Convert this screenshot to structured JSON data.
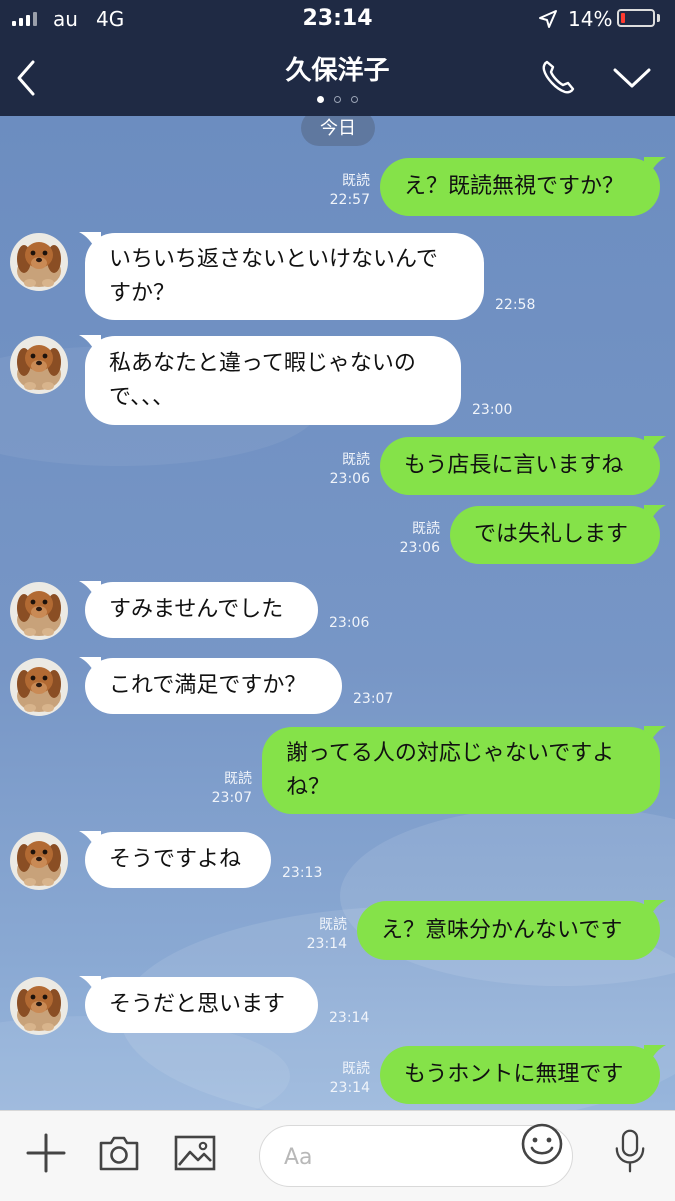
{
  "status_bar": {
    "carrier": "au",
    "network": "4G",
    "time": "23:14",
    "battery": "14%",
    "battery_level": 0.14
  },
  "nav": {
    "title": "久保洋子"
  },
  "chat": {
    "date_label": "今日",
    "messages": [
      {
        "dir": "out",
        "text": "え？既読無視ですか？",
        "read": "既読",
        "time": "22:57"
      },
      {
        "dir": "in",
        "text": "いちいち返さないといけないんで\nすか？",
        "time": "22:58"
      },
      {
        "dir": "in",
        "text": "私あなたと違って暇じゃないの\nで、、、",
        "time": "23:00"
      },
      {
        "dir": "out",
        "text": "もう店長に言いますね",
        "read": "既読",
        "time": "23:06"
      },
      {
        "dir": "out",
        "text": "では失礼します",
        "read": "既読",
        "time": "23:06"
      },
      {
        "dir": "in",
        "text": "すみませんでした",
        "time": "23:06"
      },
      {
        "dir": "in",
        "text": "これで満足ですか？",
        "time": "23:07"
      },
      {
        "dir": "out",
        "text": "謝ってる人の対応じゃないですよ\nね？",
        "read": "既読",
        "time": "23:07"
      },
      {
        "dir": "in",
        "text": "そうですよね",
        "time": "23:13"
      },
      {
        "dir": "out",
        "text": "え？意味分かんないです",
        "read": "既読",
        "time": "23:14"
      },
      {
        "dir": "in",
        "text": "そうだと思います",
        "time": "23:14"
      },
      {
        "dir": "out",
        "text": "もうホントに無理です",
        "read": "既読",
        "time": "23:14"
      }
    ]
  },
  "toolbar": {
    "input_placeholder": "Aa"
  },
  "colors": {
    "bar": "#1f2a44",
    "out_bubble": "#85e249",
    "in_bubble": "#ffffff",
    "chat_bg": "#6f8fbf"
  },
  "icons": [
    "back-chevron-icon",
    "phone-icon",
    "chevron-down-icon",
    "plus-icon",
    "camera-icon",
    "image-icon",
    "emoji-icon",
    "microphone-icon"
  ]
}
